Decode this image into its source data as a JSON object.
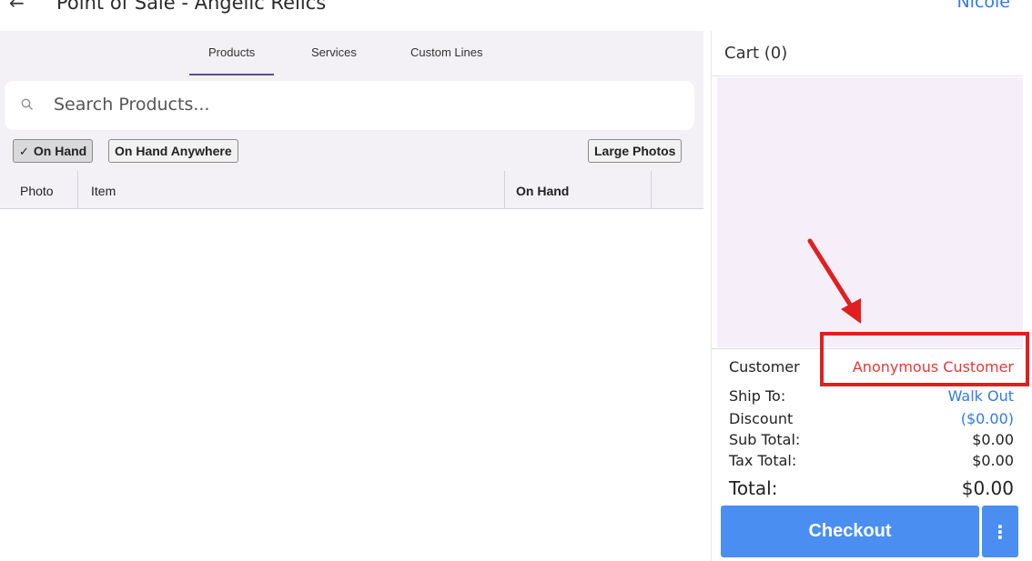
{
  "header": {
    "back_icon": "back-arrow-icon",
    "title": "Point of Sale - Angelic Relics",
    "user": "Nicole"
  },
  "tabs": [
    {
      "label": "Products",
      "active": true
    },
    {
      "label": "Services",
      "active": false
    },
    {
      "label": "Custom Lines",
      "active": false
    }
  ],
  "search": {
    "placeholder": "Search Products...",
    "value": "",
    "icon": "search-icon"
  },
  "filters": {
    "on_hand": {
      "label": "On Hand",
      "checked": true
    },
    "on_hand_anywhere": {
      "label": "On Hand Anywhere",
      "checked": false
    },
    "large_photos": {
      "label": "Large Photos",
      "checked": false
    }
  },
  "table": {
    "columns": [
      "Photo",
      "Item",
      "On Hand"
    ],
    "rows": []
  },
  "cart": {
    "title": "Cart (0)",
    "customer_label": "Customer",
    "customer_value": "Anonymous Customer",
    "ship_to_label": "Ship To:",
    "ship_to_value": "Walk Out",
    "discount_label": "Discount",
    "discount_value": "($0.00)",
    "subtotal_label": "Sub Total:",
    "subtotal_value": "$0.00",
    "tax_label": "Tax Total:",
    "tax_value": "$0.00",
    "total_label": "Total:",
    "total_value": "$0.00",
    "checkout_label": "Checkout",
    "more_icon": "more-vertical-icon"
  },
  "colors": {
    "accent_blue": "#4a8ef2",
    "link_blue": "#2f7be8",
    "highlight_red": "#e02020",
    "customer_red": "#e53935",
    "panel_bg": "#f4f1f6"
  }
}
